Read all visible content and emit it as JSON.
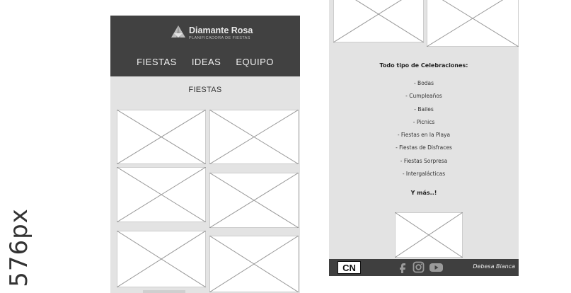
{
  "side_label": "576px",
  "brand": {
    "name": "Diamante Rosa",
    "tagline": "PLANIFICADORA DE FIESTAS"
  },
  "nav": [
    "FIESTAS",
    "IDEAS",
    "EQUIPO"
  ],
  "section_title": "FIESTAS",
  "celebrations": {
    "title": "Todo tipo de Celebraciones:",
    "items": [
      "- Bodas",
      "- Cumpleaños",
      "- Bailes",
      "- Picnics",
      "- Fiestas en la Playa",
      "- Fiestas de Disfraces",
      "- Fiestas Sorpresa",
      "- Intergalácticas"
    ],
    "more": "Y más..!"
  },
  "footer": {
    "logo_text": "CN",
    "name": "Debesa Bianca",
    "social_icons": [
      "facebook-icon",
      "instagram-icon",
      "youtube-icon"
    ]
  },
  "colors": {
    "header_bg": "#414141",
    "body_bg": "#e3e3e3",
    "footer_bg": "#3f3f3f"
  }
}
